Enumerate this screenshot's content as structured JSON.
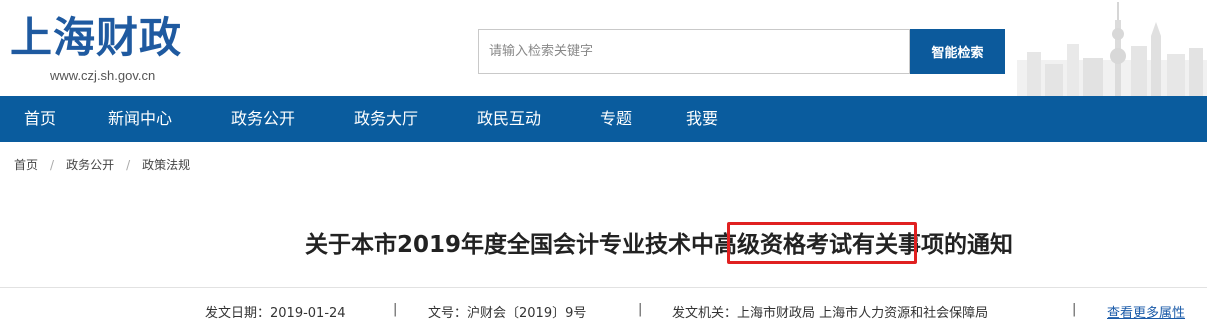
{
  "site": {
    "logo_text": "上海财政",
    "logo_url": "www.czj.sh.gov.cn"
  },
  "search": {
    "placeholder": "请输入检索关键字",
    "button_label": "智能检索"
  },
  "nav": {
    "items": [
      {
        "label": "首页"
      },
      {
        "label": "新闻中心"
      },
      {
        "label": "政务公开"
      },
      {
        "label": "政务大厅"
      },
      {
        "label": "政民互动"
      },
      {
        "label": "专题"
      },
      {
        "label": "我要"
      }
    ]
  },
  "breadcrumb": {
    "items": [
      {
        "label": "首页"
      },
      {
        "label": "政务公开"
      },
      {
        "label": "政策法规"
      }
    ],
    "separator": "/"
  },
  "article": {
    "title_before": "关于本市2019年度全国会计专业技术",
    "title_highlight": "中高级资格考试",
    "title_after": "有关事项的通知"
  },
  "meta": {
    "date": "发文日期：2019-01-24",
    "doc_number": "文号：沪财会〔2019〕9号",
    "issuer": "发文机关：上海市财政局 上海市人力资源和社会保障局",
    "separator": "|",
    "more_link": "查看更多属性"
  },
  "colors": {
    "brand_blue": "#0a5c9e",
    "highlight_red": "#e02020",
    "link_blue": "#1a5aa8"
  }
}
